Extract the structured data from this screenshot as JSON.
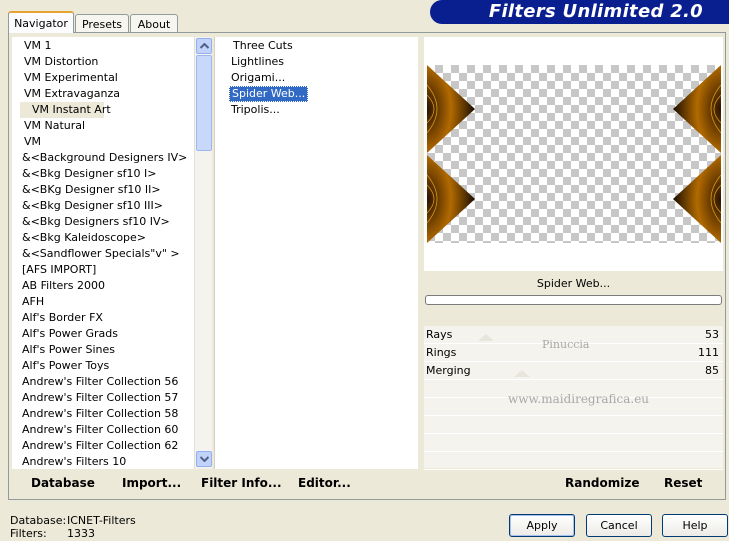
{
  "tabs": [
    "Navigator",
    "Presets",
    "About"
  ],
  "title": "Filters Unlimited 2.0",
  "categories": [
    "VM 1",
    "VM Distortion",
    "VM Experimental",
    "VM Extravaganza",
    "VM Instant Art",
    "VM Natural",
    "VM",
    "&<Background Designers IV>",
    "&<Bkg Designer sf10 I>",
    "&<BKg Designer sf10 II>",
    "&<Bkg Designer sf10 III>",
    "&<Bkg Designers sf10 IV>",
    "&<Bkg Kaleidoscope>",
    "&<Sandflower Specials\"v\" >",
    "[AFS IMPORT]",
    "AB Filters 2000",
    "AFH",
    "Alf's Border FX",
    "Alf's Power Grads",
    "Alf's Power Sines",
    "Alf's Power Toys",
    "Andrew's Filter Collection 56",
    "Andrew's Filter Collection 57",
    "Andrew's Filter Collection 58",
    "Andrew's Filter Collection 60",
    "Andrew's Filter Collection 62",
    "Andrew's Filters 10"
  ],
  "selected_category": "VM Instant Art",
  "filters": [
    "Three Cuts",
    "Lightlines",
    "Origami...",
    "Spider Web...",
    "Tripolis..."
  ],
  "selected_filter": "Spider Web...",
  "preview_name": "Spider Web...",
  "params": [
    {
      "label": "Rays",
      "value": "53"
    },
    {
      "label": "Rings",
      "value": "111"
    },
    {
      "label": "Merging",
      "value": "85"
    }
  ],
  "watermark": {
    "line1": "Pinuccia",
    "line2": "www.maidiregrafica.eu"
  },
  "toolbar": {
    "database": "Database",
    "import": "Import...",
    "filter_info": "Filter Info...",
    "editor": "Editor...",
    "randomize": "Randomize",
    "reset": "Reset"
  },
  "status": {
    "database_label": "Database:",
    "database_value": "ICNET-Filters",
    "filters_label": "Filters:",
    "filters_value": "1333"
  },
  "buttons": {
    "apply": "Apply",
    "cancel": "Cancel",
    "help": "Help"
  },
  "colors": {
    "banner": "#0a1f8f",
    "selection": "#316ac5",
    "panel": "#ece9d8"
  },
  "icons": {
    "scroll_up": "chevron-up-icon",
    "scroll_down": "chevron-down-icon"
  }
}
